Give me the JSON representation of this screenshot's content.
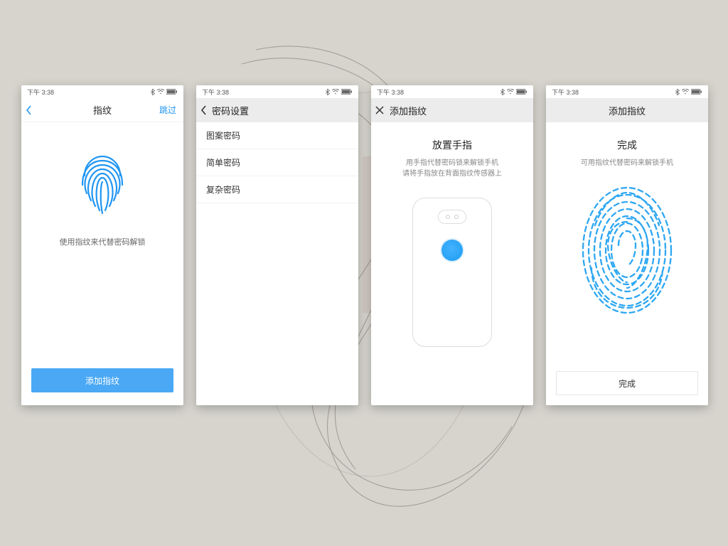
{
  "status": {
    "time": "下午 3:38"
  },
  "screen1": {
    "title": "指纹",
    "skip": "跳过",
    "caption": "使用指纹来代替密码解锁",
    "button": "添加指纹"
  },
  "screen2": {
    "title": "密码设置",
    "items": [
      "图案密码",
      "简单密码",
      "复杂密码"
    ]
  },
  "screen3": {
    "title": "添加指纹",
    "heading": "放置手指",
    "line1": "用手指代替密码锁来解锁手机",
    "line2": "请将手指放在背面指纹传感器上"
  },
  "screen4": {
    "title": "添加指纹",
    "heading": "完成",
    "sub": "可用指纹代替密码来解锁手机",
    "button": "完成"
  }
}
